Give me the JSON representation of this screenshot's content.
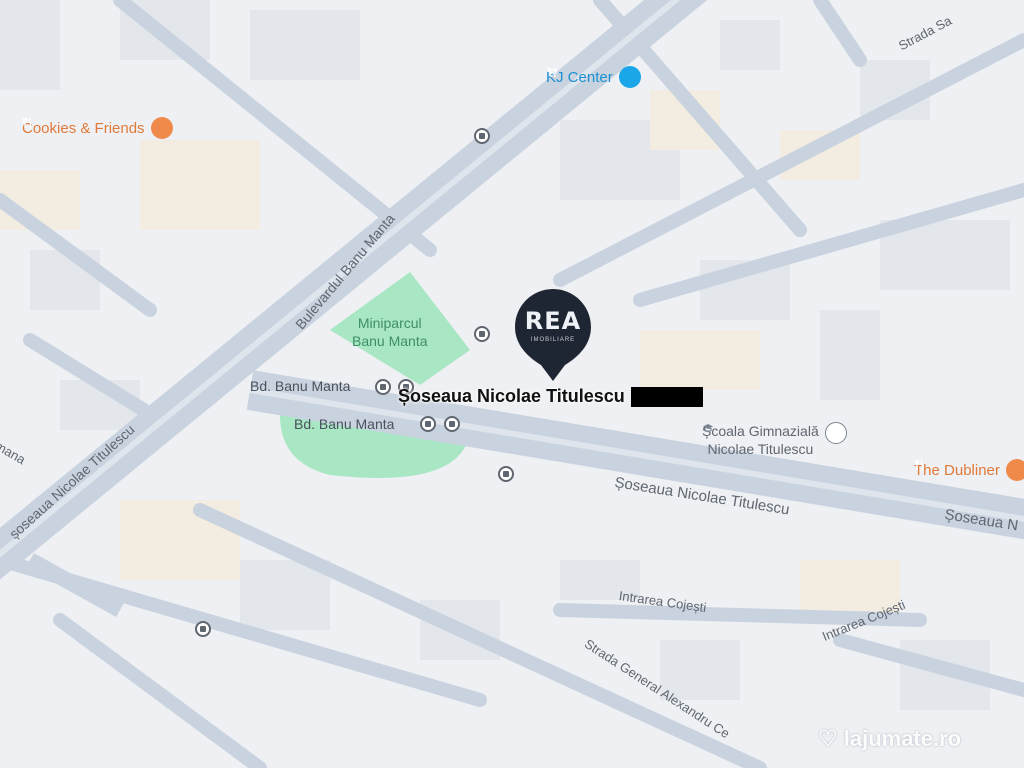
{
  "colors": {
    "background": "#eef0f3",
    "road": "#c9d3df",
    "road_edge": "#b6c2d1",
    "park": "#a8e6c4",
    "building": "#e3e6ea",
    "building_warm": "#f3ece0",
    "poi_orange": "#f08a4b",
    "poi_blue": "#1aa6e8",
    "marker": "#1f2633"
  },
  "pois": {
    "kj_center": "KJ Center",
    "cookies_friends": "Cookies & Friends",
    "the_dubliner": "The Dubliner",
    "school": "Școala Gimnazială\nNicolae Titulescu"
  },
  "places": {
    "park_line1": "Miniparcul",
    "park_line2": "Banu Manta",
    "stop_north": "Bd. Banu Manta",
    "stop_south": "Bd. Banu Manta"
  },
  "streets": {
    "bulevardul_banu_manta": "Bulevardul Banu Manta",
    "titulescu_main": "Șoseaua Nicolae Titulescu",
    "titulescu_east": "Șoseaua Nicolae Titulescu",
    "titulescu_far_east": "Șoseaua N",
    "titulescu_west": "șoseaua Nicolae Titulescu",
    "strada_sa": "Strada Sa",
    "intrarea_cojesti_1": "Intrarea Cojești",
    "intrarea_cojesti_2": "Intrarea Cojești",
    "general_alexandru": "Strada General Alexandru Ce",
    "mana": "mana"
  },
  "marker": {
    "logo_text": "REA",
    "logo_subtext": "IMOBILIARE",
    "address_label": "Șoseaua Nicolae Titulescu"
  },
  "watermark": "lajumate.ro",
  "icons": {
    "kj_center": "shopping-cart-icon",
    "cookies_friends": "restaurant-icon",
    "the_dubliner": "restaurant-icon",
    "school": "school-icon",
    "bus_stop": "bus-stop-icon",
    "marker": "map-pin-icon"
  }
}
